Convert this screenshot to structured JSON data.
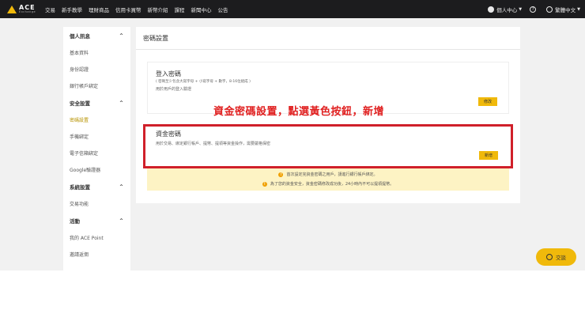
{
  "logo": {
    "title": "ACE",
    "subtitle": "Exchange"
  },
  "nav": {
    "items": [
      "交易",
      "新手教學",
      "理財商品",
      "信用卡買幣",
      "新幣介紹",
      "課程",
      "新聞中心",
      "公告"
    ]
  },
  "nav_right": {
    "account": "個人中心",
    "help_icon_glyph": "?",
    "language": "繁體中文"
  },
  "sidebar": {
    "sections": [
      {
        "title": "個人訊息",
        "items": [
          "基本資料",
          "身份認證",
          "銀行帳戶綁定"
        ]
      },
      {
        "title": "安全設置",
        "items": [
          "密碼設置",
          "手機綁定",
          "電子信箱綁定",
          "Google驗證器"
        ]
      },
      {
        "title": "系統設置",
        "items": [
          "交易功能"
        ]
      },
      {
        "title": "活動",
        "items": [
          "我的 ACE Point",
          "邀請返佣"
        ]
      }
    ],
    "active_item": "密碼設置"
  },
  "main": {
    "title": "密碼設置",
    "login_password": {
      "title": "登入密碼",
      "note": "( 密碼至少包含大寫字母 + 小寫字母 + 數字，8-16位組成 )",
      "description": "用於用戶的登入驗證",
      "button": "修改"
    },
    "fund_password": {
      "title": "資金密碼",
      "description": "用於交易、綁定銀行帳戶、提幣、提領等資金操作，需要嚴格保密",
      "button": "新增"
    },
    "notices": [
      "首次設定完資金密碼之用戶，請進行銀行帳戶綁定。",
      "為了您的資金安全，資金密碼修改成功後，24小時內不可以提領提幣。"
    ],
    "notice_icon": "!"
  },
  "annotation": "資金密碼設置，點選黃色按鈕，新增",
  "chat": {
    "label": "交談"
  },
  "colors": {
    "accent": "#f0b90b",
    "annotation": "#e02020",
    "active": "#b79300",
    "topbar": "#1c1c1e"
  }
}
